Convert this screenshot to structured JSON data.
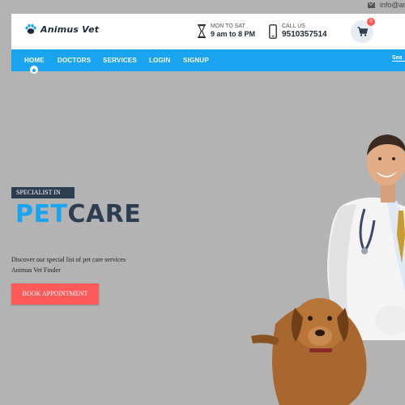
{
  "topbar": {
    "email": "info@ani",
    "mail_icon": "mail-icon"
  },
  "header": {
    "logo_text": "Animus Vet",
    "hours": {
      "label": "MON TO SAT",
      "value": "9 am to 8 PM",
      "icon": "hourglass-icon"
    },
    "call": {
      "label": "CALL US",
      "value": "9510357514",
      "icon": "phone-icon"
    },
    "cart": {
      "count": "0",
      "icon": "cart-icon"
    }
  },
  "nav": {
    "items": [
      {
        "label": "HOME"
      },
      {
        "label": "DOCTORS"
      },
      {
        "label": "SERVICES"
      },
      {
        "label": "LOGIN"
      },
      {
        "label": "SIGNUP"
      }
    ],
    "search_text": "Sea",
    "active_item": "HOME"
  },
  "hero": {
    "badge": "SPECIALIST IN",
    "headline_part1": "PET",
    "headline_part2": "CARE",
    "desc_line1": "Discover our special list of pet care services",
    "desc_line2": "Animus Vet Finder",
    "cta_label": "BOOK APPOINTMENT"
  },
  "colors": {
    "accent": "#1aa3ee",
    "dark": "#2e3e52",
    "cta": "#ff5a5a",
    "background": "#b3b3b3"
  }
}
